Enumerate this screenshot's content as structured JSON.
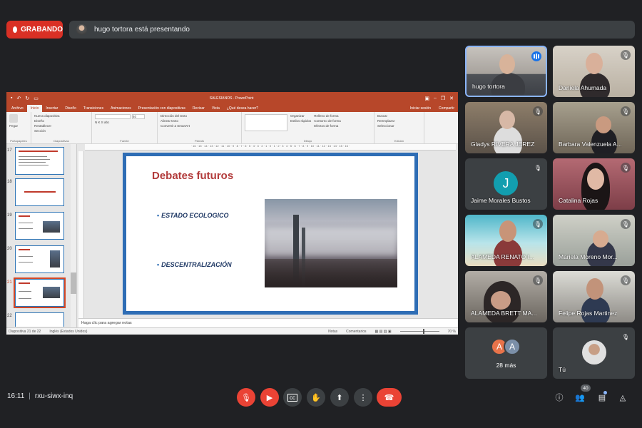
{
  "recording": {
    "label": "GRABANDO"
  },
  "presenting": {
    "text": "hugo tortora está presentando"
  },
  "powerpoint": {
    "title": "SALESIANOS - PowerPoint",
    "signin": "Iniciar sesión",
    "share": "Compartir",
    "tabs": [
      "Archivo",
      "Inicio",
      "Insertar",
      "Diseño",
      "Transiciones",
      "Animaciones",
      "Presentación con diapositivas",
      "Revisar",
      "Vista",
      "¿Qué desea hacer?"
    ],
    "ribbon": {
      "paste": "Pegar",
      "clipboard": "Portapapeles",
      "new_slide": "Nueva diapositiva",
      "layout": "Diseño",
      "reset": "Restablecer",
      "section": "Sección",
      "slides": "Diapositivas",
      "font_size": "40",
      "font": "Fuente",
      "paragraph": "Párrafo",
      "text_direction": "Dirección del texto",
      "align_text": "Alinear texto",
      "smartart": "Convertir a SmartArt",
      "draw": "Dibujo",
      "arrange": "Organizar",
      "quick_styles": "Estilos rápidos",
      "fill": "Relleno de forma",
      "outline": "Contorno de forma",
      "effects": "Efectos de forma",
      "find": "Buscar",
      "replace": "Reemplazar",
      "select": "Seleccionar",
      "editing": "Edición"
    },
    "thumbnails": [
      {
        "num": "17"
      },
      {
        "num": "18"
      },
      {
        "num": "19"
      },
      {
        "num": "20"
      },
      {
        "num": "21"
      },
      {
        "num": "22"
      }
    ],
    "slide": {
      "title": "Debates futuros",
      "bullet1": "ESTADO ECOLOGICO",
      "bullet2": "DESCENTRALIZACIÓN"
    },
    "notes_placeholder": "Haga clic para agregar notas",
    "status": {
      "slide_count": "Diapositiva 21 de 22",
      "language": "Inglés (Estados Unidos)",
      "notes": "Notas",
      "comments": "Comentarios",
      "zoom": "70 %"
    }
  },
  "participants": [
    {
      "name": "hugo tortora"
    },
    {
      "name": "Daniela Ahumada"
    },
    {
      "name": "Gladys RIVERA JEREZ"
    },
    {
      "name": "Barbara Valenzuela A..."
    },
    {
      "name": "Jaime Morales Bustos",
      "initial": "J"
    },
    {
      "name": "Catalina Rojas"
    },
    {
      "name": "ALAMEDA RENATO I..."
    },
    {
      "name": "Mariela Moreno Mor..."
    },
    {
      "name": "ALAMEDA BRETT MA..."
    },
    {
      "name": "Felipe Rojas Martinez"
    },
    {
      "more": "28 más",
      "initials": [
        "A",
        "A"
      ]
    },
    {
      "name": "Tú"
    }
  ],
  "meeting": {
    "time": "16:11",
    "code": "rxu-siwx-inq",
    "people_count": "40"
  },
  "colors": {
    "ppt_red": "#b7472a",
    "meet_red": "#ea4335",
    "slide_border": "#2e6db5"
  }
}
